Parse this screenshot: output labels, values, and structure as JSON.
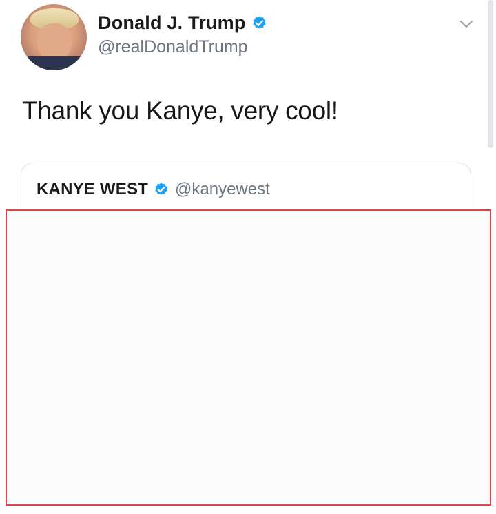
{
  "tweet": {
    "author": {
      "display_name": "Donald J. Trump",
      "handle": "@realDonaldTrump",
      "verified": true
    },
    "text": "Thank you Kanye, very cool!",
    "quoted": {
      "display_name": "KANYE WEST",
      "handle": "@kanyewest",
      "verified": true
    }
  },
  "icons": {
    "verified": "verified-badge-icon",
    "menu": "chevron-down-icon"
  },
  "colors": {
    "verified_blue": "#1da1f2",
    "redaction_border": "#d94848",
    "secondary_text": "#6b7680"
  }
}
